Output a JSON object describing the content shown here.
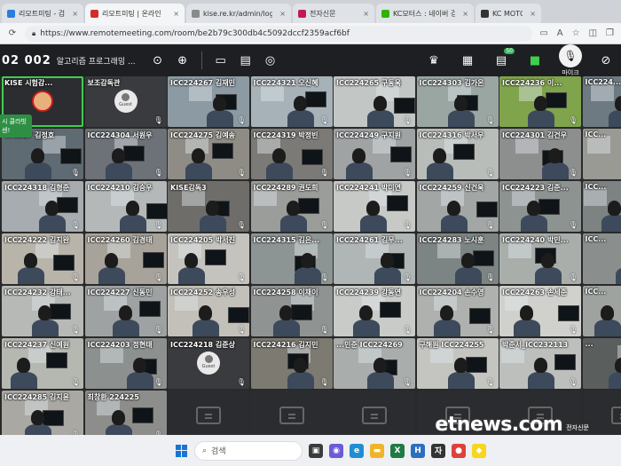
{
  "browser": {
    "tabs": [
      {
        "label": "리모트미팅 - 검색",
        "active": false,
        "color": "#2b7de0"
      },
      {
        "label": "리모트미팅 | 온라인",
        "active": true,
        "color": "#d62b2b"
      },
      {
        "label": "kise.re.kr/admin/login.ph",
        "active": false,
        "color": "#8a8a8a"
      },
      {
        "label": "전자신문",
        "active": false,
        "color": "#c2185b"
      },
      {
        "label": "KC모터스 : 네이버 검색",
        "active": false,
        "color": "#2db400"
      },
      {
        "label": "KC MOTORS",
        "active": false,
        "color": "#333333"
      }
    ],
    "url": "https://www.remotemeeting.com/room/be2b79c300db4c5092dccf2359acf6bf"
  },
  "meeting": {
    "room_id": "02 002",
    "room_name": "알고리즘 프로그래밍 ...",
    "mic_label": "마이크",
    "chat_badge": "50",
    "popup_text": "시 클라빗\n센!"
  },
  "tiles": [
    {
      "name": "KISE 시험감...",
      "type": "avatar",
      "muted": false,
      "highlight": true
    },
    {
      "name": "보조감독관",
      "type": "guest",
      "muted": true
    },
    {
      "name": "ICC224267 김재민",
      "type": "video",
      "muted": true,
      "bg": "#8b9aa3"
    },
    {
      "name": "ICC224321 오신혜",
      "type": "video",
      "muted": true,
      "bg": "#a7b2b8"
    },
    {
      "name": "ICC224265 구동욱",
      "type": "video",
      "muted": true,
      "bg": "#c2c6c4"
    },
    {
      "name": "ICC224303 김가온",
      "type": "video",
      "muted": true,
      "bg": "#9aa6a2"
    },
    {
      "name": "ICC224236 이...",
      "type": "video",
      "muted": true,
      "bg": "#7fa44c"
    },
    {
      "name": "ICC224...",
      "type": "video",
      "muted": true,
      "bg": "#6e7a82"
    },
    {
      "name": "...4317 김정호",
      "type": "video",
      "muted": true,
      "bg": "#5f6b72"
    },
    {
      "name": "ICC224304 서원우",
      "type": "video",
      "muted": true,
      "bg": "#6d7278"
    },
    {
      "name": "ICC224275 김예송",
      "type": "video",
      "muted": true,
      "bg": "#8f8c86"
    },
    {
      "name": "ICC224319 박정빈",
      "type": "video",
      "muted": true,
      "bg": "#7c7a76"
    },
    {
      "name": "ICC224249 구지원",
      "type": "video",
      "muted": true,
      "bg": "#9fa3a3"
    },
    {
      "name": "ICC224316 박서우",
      "type": "video",
      "muted": true,
      "bg": "#b9bdb9"
    },
    {
      "name": "ICC224301 김건우",
      "type": "video",
      "muted": true,
      "bg": "#8d8f8e"
    },
    {
      "name": "ICC...",
      "type": "video",
      "muted": true,
      "bg": "#9a9a94"
    },
    {
      "name": "ICC224318 김형준",
      "type": "video",
      "muted": true,
      "bg": "#a6acb0"
    },
    {
      "name": "ICC224210 김승우",
      "type": "video",
      "muted": true,
      "bg": "#b4b8b9"
    },
    {
      "name": "KISE감독3",
      "type": "video",
      "muted": true,
      "bg": "#6f6d6a"
    },
    {
      "name": "ICC224289 권도희",
      "type": "video",
      "muted": true,
      "bg": "#9b9d9a"
    },
    {
      "name": "ICC224241 박미연",
      "type": "video",
      "muted": true,
      "bg": "#c7c9c6"
    },
    {
      "name": "ICC224259 신건욱",
      "type": "video",
      "muted": true,
      "bg": "#a2a7a6"
    },
    {
      "name": "ICC224223 김준...",
      "type": "video",
      "muted": true,
      "bg": "#8c9390"
    },
    {
      "name": "ICC...",
      "type": "video",
      "muted": true,
      "bg": "#7d8282"
    },
    {
      "name": "ICC224222 김지완",
      "type": "video",
      "muted": true,
      "bg": "#b9b4aa"
    },
    {
      "name": "ICC224260 김경태",
      "type": "video",
      "muted": true,
      "bg": "#a8a39a"
    },
    {
      "name": "ICC224205 박서진",
      "type": "video",
      "muted": true,
      "bg": "#c4c3be"
    },
    {
      "name": "ICC224315 김은...",
      "type": "video",
      "muted": true,
      "bg": "#8d9594"
    },
    {
      "name": "ICC224261 김무...",
      "type": "video",
      "muted": true,
      "bg": "#b0b5b5"
    },
    {
      "name": "ICC224283 노시훈",
      "type": "video",
      "muted": true,
      "bg": "#7c8584"
    },
    {
      "name": "ICC224240 박민...",
      "type": "video",
      "muted": true,
      "bg": "#a9aeab"
    },
    {
      "name": "ICC...",
      "type": "video",
      "muted": true,
      "bg": "#8a8f8d"
    },
    {
      "name": "ICC224232 강태...",
      "type": "video",
      "muted": true,
      "bg": "#b7b9b6"
    },
    {
      "name": "ICC224227 신동민",
      "type": "video",
      "muted": true,
      "bg": "#9ea2a2"
    },
    {
      "name": "ICC224252 송우성",
      "type": "video",
      "muted": true,
      "bg": "#c2c0b9"
    },
    {
      "name": "ICC224258 이채이",
      "type": "video",
      "muted": true,
      "bg": "#8f9392"
    },
    {
      "name": "ICC224239 강동연",
      "type": "video",
      "muted": true,
      "bg": "#c9cbc8"
    },
    {
      "name": "ICC224204 손수영",
      "type": "video",
      "muted": true,
      "bg": "#aeb1ad"
    },
    {
      "name": "ICC224263 손세준",
      "type": "video",
      "muted": true,
      "bg": "#d0d1cd"
    },
    {
      "name": "ICC...",
      "type": "video",
      "muted": true,
      "bg": "#9ea3a0"
    },
    {
      "name": "ICC224237 신예원",
      "type": "video",
      "muted": true,
      "bg": "#b5b7b1"
    },
    {
      "name": "ICC224203 정현태",
      "type": "video",
      "muted": true,
      "bg": "#8c908f"
    },
    {
      "name": "ICC224218 김준상",
      "type": "guest",
      "muted": true
    },
    {
      "name": "ICC224216 김지민",
      "type": "video",
      "muted": true,
      "bg": "#7d7a72"
    },
    {
      "name": "...민준 ICC224269",
      "type": "video",
      "muted": true,
      "bg": "#a9adab"
    },
    {
      "name": "구해원 ICC224255",
      "type": "video",
      "muted": true,
      "bg": "#c4c5c1"
    },
    {
      "name": "박준서_ICC232113",
      "type": "video",
      "muted": true,
      "bg": "#bcbfbc"
    },
    {
      "name": "...",
      "type": "video",
      "muted": true,
      "bg": "#5a5e5d"
    },
    {
      "name": "ICC224285 김지윤",
      "type": "video",
      "muted": true,
      "bg": "#aaa8a2"
    },
    {
      "name": "최창환 224225",
      "type": "video",
      "muted": true,
      "bg": "#8d8e8b"
    },
    {
      "name": "",
      "type": "empty"
    },
    {
      "name": "",
      "type": "empty"
    },
    {
      "name": "",
      "type": "empty"
    },
    {
      "name": "",
      "type": "empty"
    },
    {
      "name": "",
      "type": "empty"
    },
    {
      "name": "",
      "type": "empty"
    }
  ],
  "taskbar": {
    "search_placeholder": "검색",
    "apps": [
      {
        "icon": "file-explorer-icon",
        "color": "#3b3b3b",
        "glyph": "▣"
      },
      {
        "icon": "meet-icon",
        "color": "#6b5bd6",
        "glyph": "◉"
      },
      {
        "icon": "edge-icon",
        "color": "#1f8fd4",
        "glyph": "e"
      },
      {
        "icon": "folder-icon",
        "color": "#f0b429",
        "glyph": "▬"
      },
      {
        "icon": "excel-icon",
        "color": "#1f7a44",
        "glyph": "X"
      },
      {
        "icon": "hangul-icon",
        "color": "#2c6fbd",
        "glyph": "H"
      },
      {
        "icon": "app-icon",
        "color": "#333333",
        "glyph": "자"
      },
      {
        "icon": "chrome-icon",
        "color": "#e0403b",
        "glyph": "●"
      },
      {
        "icon": "kakaotalk-icon",
        "color": "#f7d61b",
        "glyph": "◆"
      }
    ]
  },
  "watermark": {
    "logo": "etnews.com",
    "sub": "전자신문"
  }
}
